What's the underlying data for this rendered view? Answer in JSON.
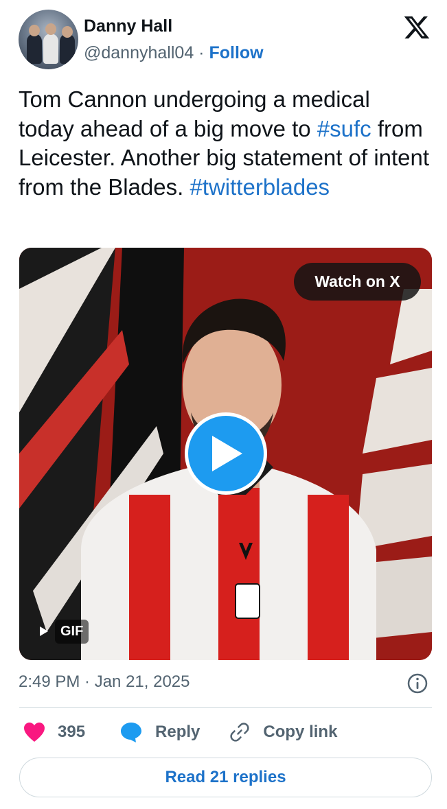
{
  "author": {
    "display_name": "Danny Hall",
    "handle": "@dannyhall04",
    "separator": "·",
    "follow_label": "Follow"
  },
  "tweet": {
    "text_1": "Tom Cannon undergoing a medical today ahead of a big move to ",
    "hashtag_1": "#sufc",
    "text_2": " from Leicester. Another big statement of intent from the Blades. ",
    "hashtag_2": "#twitterblades"
  },
  "media": {
    "watch_label": "Watch on X",
    "gif_label": "GIF",
    "icon": "play-icon"
  },
  "meta": {
    "timestamp": "2:49 PM · Jan 21, 2025"
  },
  "actions": {
    "like_count": "395",
    "reply_label": "Reply",
    "copy_label": "Copy link"
  },
  "footer": {
    "read_replies_label": "Read 21 replies"
  },
  "colors": {
    "link": "#1d72c9",
    "like": "#f91880",
    "play": "#1d9bf0",
    "muted": "#536471"
  }
}
